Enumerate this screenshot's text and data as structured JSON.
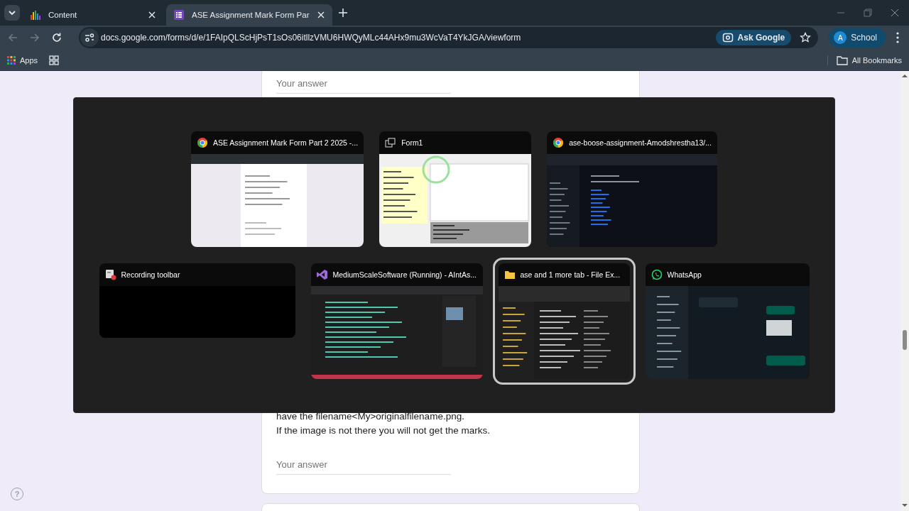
{
  "browser": {
    "tabs": [
      {
        "title": "Content",
        "selected": false
      },
      {
        "title": "ASE Assignment Mark Form Par",
        "selected": true
      }
    ],
    "address": "docs.google.com/forms/d/e/1FAIpQLScHjPsT1sOs06itllzVMU6HWQyMLc44AHx9mu3WcVaT4YkJGA/viewform",
    "ask_google": "Ask Google",
    "profile": {
      "initial": "A",
      "label": "School"
    },
    "bookmarks": [
      {
        "label": "Apps"
      }
    ],
    "all_bookmarks": "All Bookmarks"
  },
  "form": {
    "questions": [
      {
        "placeholder": "Your answer"
      },
      {
        "description_lines": [
          "have the filename<My>originalfilename.png.",
          "If the image is not there you will not get the marks."
        ],
        "placeholder": "Your answer"
      }
    ],
    "help_button": "?"
  },
  "task_switcher": {
    "rows": [
      {
        "windows": [
          {
            "title": "ASE Assignment Mark Form Part 2 2025 -...",
            "kind": "webform",
            "selected": false
          },
          {
            "title": "Form1",
            "kind": "winform",
            "selected": false
          },
          {
            "title": "ase-boose-assignment-Amodshrestha13/...",
            "kind": "webcode",
            "selected": false
          }
        ]
      },
      {
        "windows": [
          {
            "title": "Recording toolbar",
            "kind": "recorder",
            "selected": false
          },
          {
            "title": "MediumScaleSoftware (Running) - AIntAs...",
            "kind": "ide",
            "selected": false
          },
          {
            "title": "ase and 1 more tab - File Ex...",
            "kind": "explorer",
            "selected": true
          },
          {
            "title": "WhatsApp",
            "kind": "chat",
            "selected": false
          }
        ]
      }
    ]
  }
}
